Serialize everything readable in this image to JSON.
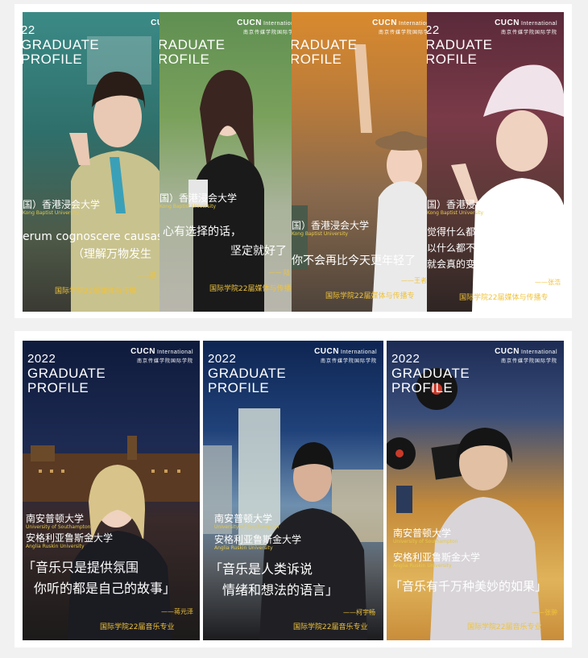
{
  "colors": {
    "background": "#f1f1f1",
    "accent_gold": "#f0c33b"
  },
  "logo": {
    "brand": "CUCN",
    "intl": "International",
    "sub": "南京传媒学院国际学院"
  },
  "title": {
    "year": "2022",
    "line1": "GRADUATE",
    "line2": "PROFILE"
  },
  "top_title": {
    "year": "22",
    "line1": "RADUATE",
    "line2": "ROFILE"
  },
  "top_panels": [
    {
      "school_cn": "国）香港浸会大学",
      "school_en": "Kong Baptist University",
      "quote1": "erum cognoscere causas",
      "quote2": "（理解万物发生",
      "sign": "——蔡",
      "major": "国际学院22届媒体与传播"
    },
    {
      "school_cn": "国）香港浸会大学",
      "school_en": "Kong Baptist University",
      "quote1": "心有选择的话，",
      "quote2": "坚定就好了",
      "sign": "—— 陆",
      "major": "国际学院22届媒体与传播"
    },
    {
      "school_cn": "国）香港浸会大学",
      "school_en": "Kong Baptist University",
      "quote1": "你不会再比今天更年轻了",
      "sign": "——王者",
      "major": "国际学院22届媒体与传播专"
    },
    {
      "school_cn": "国）香港浸会大学",
      "school_en": "Kong Baptist University",
      "quote1": "觉得什么都做不到",
      "quote2": "以什么都不去做的话，",
      "quote3": "就会真的变成什么都不能做的人",
      "sign": "——张浩",
      "major": "国际学院22届媒体与传播专"
    }
  ],
  "bottom_panels": [
    {
      "school1_cn": "南安普顿大学",
      "school1_en": "University of Southampton",
      "school2_cn": "安格利亚鲁斯金大学",
      "school2_en": "Anglia Ruskin University",
      "quote1": "「音乐只是提供氛围",
      "quote2": "你听的都是自己的故事」",
      "sign": "——蒋元泽",
      "major": "国际学院22届音乐专业"
    },
    {
      "school1_cn": "南安普顿大学",
      "school1_en": "University of Southampton",
      "school2_cn": "安格利亚鲁斯金大学",
      "school2_en": "Anglia Ruskin University",
      "quote1": "「音乐是人类诉说",
      "quote2": "情绪和想法的语言」",
      "sign": "——柯宇畅",
      "major": "国际学院22届音乐专业"
    },
    {
      "school1_cn": "南安普顿大学",
      "school1_en": "University of Southampton",
      "school2_cn": "安格利亚鲁斯金大学",
      "school2_en": "Anglia Ruskin University",
      "quote1": "「音乐有千万种美妙的如果」",
      "sign": "——张翀",
      "major": "国际学院22届音乐专业"
    }
  ]
}
